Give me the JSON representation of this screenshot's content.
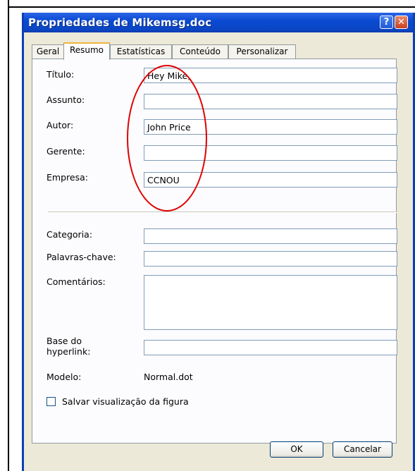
{
  "window": {
    "title": "Propriedades de Mikemsg.doc",
    "help_glyph": "?",
    "close_glyph": "✕"
  },
  "tabs": [
    {
      "label": "Geral",
      "active": false
    },
    {
      "label": "Resumo",
      "active": true
    },
    {
      "label": "Estatísticas",
      "active": false
    },
    {
      "label": "Conteúdo",
      "active": false
    },
    {
      "label": "Personalizar",
      "active": false
    }
  ],
  "fields": {
    "titulo": {
      "label": "Título:",
      "value": "Hey Mike,"
    },
    "assunto": {
      "label": "Assunto:",
      "value": ""
    },
    "autor": {
      "label": "Autor:",
      "value": "John Price"
    },
    "gerente": {
      "label": "Gerente:",
      "value": ""
    },
    "empresa": {
      "label": "Empresa:",
      "value": "CCNOU"
    },
    "categoria": {
      "label": "Categoria:",
      "value": ""
    },
    "palavras": {
      "label": "Palavras-chave:",
      "value": ""
    },
    "comentarios": {
      "label": "Comentários:",
      "value": ""
    },
    "base": {
      "label_line1": "Base do",
      "label_line2": "hyperlink:",
      "value": ""
    }
  },
  "modelo": {
    "label": "Modelo:",
    "value": "Normal.dot"
  },
  "checkbox": {
    "label": "Salvar visualização da figura",
    "checked": false
  },
  "buttons": {
    "ok": "OK",
    "cancel": "Cancelar"
  },
  "annotation": {
    "color": "#e00000"
  }
}
